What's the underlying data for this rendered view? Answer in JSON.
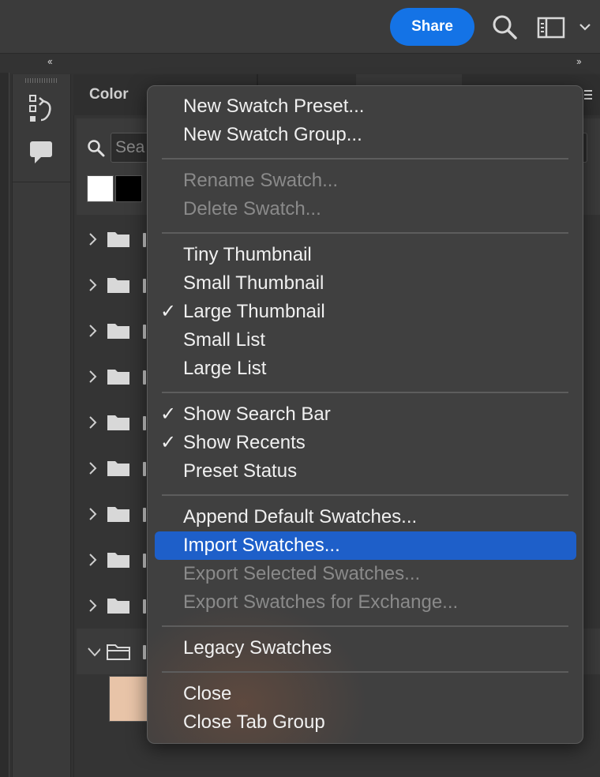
{
  "topbar": {
    "share_label": "Share",
    "search_icon": "search-icon",
    "workspace_icon": "workspace-layout-icon",
    "dropdown_icon": "chevron-down-icon"
  },
  "collapse": {
    "left": "‹‹",
    "right": "››"
  },
  "panel": {
    "tab_label": "Color",
    "search_placeholder": "Sea",
    "recent_swatches": [
      "#ffffff",
      "#000000"
    ],
    "folder_count": 10
  },
  "menu": {
    "items": [
      {
        "label": "New Swatch Preset...",
        "checked": false,
        "disabled": false
      },
      {
        "label": "New Swatch Group...",
        "checked": false,
        "disabled": false
      },
      {
        "label": "Rename Swatch...",
        "checked": false,
        "disabled": true
      },
      {
        "label": "Delete Swatch...",
        "checked": false,
        "disabled": true
      },
      {
        "label": "Tiny Thumbnail",
        "checked": false,
        "disabled": false
      },
      {
        "label": "Small Thumbnail",
        "checked": false,
        "disabled": false
      },
      {
        "label": "Large Thumbnail",
        "checked": true,
        "disabled": false
      },
      {
        "label": "Small List",
        "checked": false,
        "disabled": false
      },
      {
        "label": "Large List",
        "checked": false,
        "disabled": false
      },
      {
        "label": "Show Search Bar",
        "checked": true,
        "disabled": false
      },
      {
        "label": "Show Recents",
        "checked": true,
        "disabled": false
      },
      {
        "label": "Preset Status",
        "checked": false,
        "disabled": false
      },
      {
        "label": "Append Default Swatches...",
        "checked": false,
        "disabled": false
      },
      {
        "label": "Import Swatches...",
        "checked": false,
        "disabled": false,
        "highlighted": true
      },
      {
        "label": "Export Selected Swatches...",
        "checked": false,
        "disabled": true
      },
      {
        "label": "Export Swatches for Exchange...",
        "checked": false,
        "disabled": true
      },
      {
        "label": "Legacy Swatches",
        "checked": false,
        "disabled": false
      },
      {
        "label": "Close",
        "checked": false,
        "disabled": false
      },
      {
        "label": "Close Tab Group",
        "checked": false,
        "disabled": false
      }
    ],
    "check_glyph": "✓"
  },
  "colors": {
    "accent": "#1473e6",
    "highlight": "#1e5fc9",
    "menu_bg": "#404040",
    "disabled_text": "#8a8a8a"
  }
}
